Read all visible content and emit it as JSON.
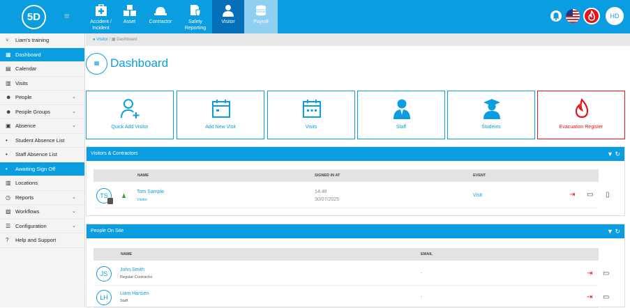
{
  "logo": {
    "text": "5D"
  },
  "modules": [
    {
      "label": "Accident / Incident",
      "icon": "first-aid-kit-icon"
    },
    {
      "label": "Asset",
      "icon": "boxes-icon"
    },
    {
      "label": "Contractor",
      "icon": "hard-hat-icon"
    },
    {
      "label": "Safety Reporting",
      "icon": "report-shield-icon"
    },
    {
      "label": "Visitor",
      "icon": "person-icon"
    },
    {
      "label": "Payroll",
      "icon": "coins-icon"
    }
  ],
  "header_right": {
    "user_initials": "HD"
  },
  "sidebar": {
    "items": [
      {
        "label": "Liam's training",
        "icon": "branch-icon"
      },
      {
        "label": "Dashboard",
        "icon": "grid-icon"
      },
      {
        "label": "Calendar",
        "icon": "calendar-icon"
      },
      {
        "label": "Visits",
        "icon": "calendar-grid-icon"
      },
      {
        "label": "People",
        "icon": "people-icon"
      },
      {
        "label": "People Groups",
        "icon": "people-group-icon"
      },
      {
        "label": "Absence",
        "icon": "absence-icon"
      },
      {
        "label": "Student Absence List",
        "icon": "dot-icon"
      },
      {
        "label": "Staff Absence List",
        "icon": "dot-icon"
      },
      {
        "label": "Awaiting Sign Off",
        "icon": "dot-icon"
      },
      {
        "label": "Locations",
        "icon": "building-icon"
      },
      {
        "label": "Reports",
        "icon": "clock-icon"
      },
      {
        "label": "Workflows",
        "icon": "image-icon"
      },
      {
        "label": "Configuration",
        "icon": "sliders-icon"
      },
      {
        "label": "Help and Support",
        "icon": "question-icon"
      }
    ]
  },
  "breadcrumb": {
    "visitor": "Visitor",
    "separator": "/",
    "dashboard": "Dashboard"
  },
  "page": {
    "title": "Dashboard"
  },
  "cards": [
    {
      "label": "Quick Add Visitor"
    },
    {
      "label": "Add New Visit"
    },
    {
      "label": "Visits"
    },
    {
      "label": "Staff"
    },
    {
      "label": "Students"
    },
    {
      "label": "Evacuation Register"
    }
  ],
  "visitors_panel": {
    "title": "Visitors & Contractors",
    "columns": {
      "name": "NAME",
      "signed_in": "SIGNED IN AT",
      "event": "EVENT"
    },
    "rows": [
      {
        "initials": "TS",
        "name": "Tom Sample",
        "type": "Visitor",
        "time": "14:48",
        "date": "30/07/2025",
        "event": "Visit"
      }
    ]
  },
  "onsite_panel": {
    "title": "People On Site",
    "columns": {
      "name": "NAME",
      "email": "EMAIL"
    },
    "rows": [
      {
        "initials": "JS",
        "name": "John Smith",
        "type": "Regular Contractor",
        "email": "-"
      },
      {
        "initials": "LH",
        "name": "Liam Hansen",
        "type": "Staff",
        "email": "-"
      }
    ]
  },
  "colors": {
    "accent": "#0a9de0",
    "active": "#0570b9",
    "danger": "#e8131a"
  }
}
